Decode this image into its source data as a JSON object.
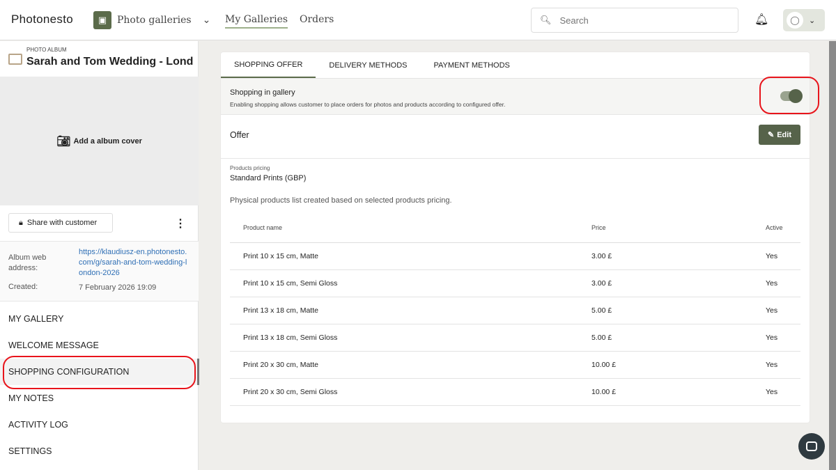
{
  "header": {
    "logo": "Photonesto",
    "gallery_selector": "Photo galleries",
    "nav": [
      "My Galleries",
      "Orders"
    ],
    "search_placeholder": "Search"
  },
  "sidebar": {
    "album_label": "PHOTO ALBUM",
    "album_title": "Sarah and Tom Wedding - Lond...",
    "add_cover": "Add a album cover",
    "share_button": "Share with customer",
    "web_address_label": "Album web address:",
    "web_address": "https://klaudiusz-en.photonesto.com/g/sarah-and-tom-wedding-london-2026",
    "created_label": "Created:",
    "created": "7 February 2026 19:09",
    "menu": [
      "MY GALLERY",
      "WELCOME MESSAGE",
      "SHOPPING CONFIGURATION",
      "MY NOTES",
      "ACTIVITY LOG",
      "SETTINGS"
    ]
  },
  "main": {
    "tabs": [
      "SHOPPING OFFER",
      "DELIVERY METHODS",
      "PAYMENT METHODS"
    ],
    "shopping_title": "Shopping in gallery",
    "shopping_desc": "Enabling shopping allows customer to place orders for photos and products according to configured offer.",
    "shopping_enabled": true,
    "offer_title": "Offer",
    "edit_label": "Edit",
    "pricing_label": "Products pricing",
    "pricing_value": "Standard Prints (GBP)",
    "physical_note": "Physical products list created based on selected products pricing.",
    "columns": [
      "Product name",
      "Price",
      "Active"
    ],
    "rows": [
      [
        "Print 10 x 15 cm, Matte",
        "3.00 £",
        "Yes"
      ],
      [
        "Print 10 x 15 cm, Semi Gloss",
        "3.00 £",
        "Yes"
      ],
      [
        "Print 13 x 18 cm, Matte",
        "5.00 £",
        "Yes"
      ],
      [
        "Print 13 x 18 cm, Semi Gloss",
        "5.00 £",
        "Yes"
      ],
      [
        "Print 20 x 30 cm, Matte",
        "10.00 £",
        "Yes"
      ],
      [
        "Print 20 x 30 cm, Semi Gloss",
        "10.00 £",
        "Yes"
      ]
    ]
  },
  "colors": {
    "accent": "#56634a",
    "annotation": "#e8141b"
  }
}
